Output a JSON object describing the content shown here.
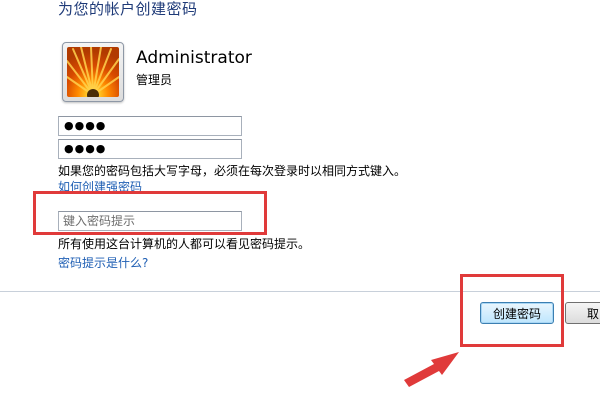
{
  "dialog": {
    "title": "为您的帐户创建密码"
  },
  "account": {
    "name": "Administrator",
    "role": "管理员"
  },
  "password": {
    "masked": "●●●●",
    "confirm_masked": "●●●●"
  },
  "caps_note": "如果您的密码包括大写字母，必须在每次登录时以相同方式键入。",
  "strong_password_link": "如何创建强密码",
  "hint": {
    "placeholder": "键入密码提示",
    "note": "所有使用这台计算机的人都可以看见密码提示。",
    "link": "密码提示是什么?"
  },
  "buttons": {
    "create": "创建密码",
    "cancel": "取"
  },
  "annotation": {
    "color": "#e03a3a"
  }
}
